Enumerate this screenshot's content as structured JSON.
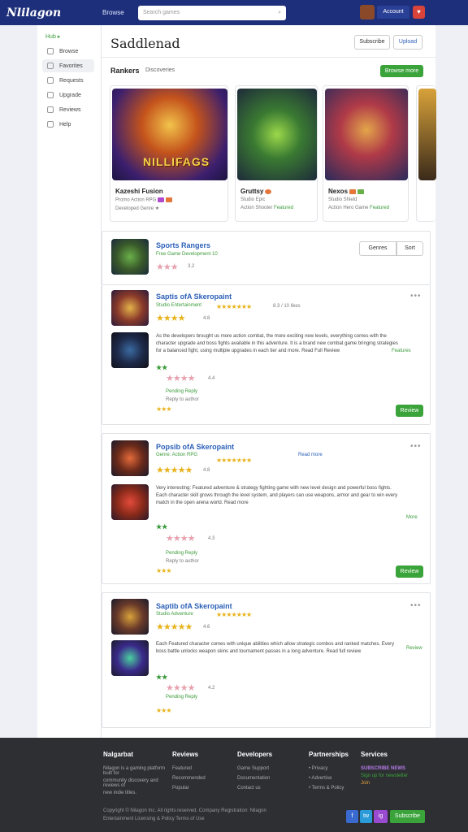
{
  "header": {
    "logo": "Nlilagon",
    "nav": "Browse",
    "search_placeholder": "Search games",
    "search_icon": "search-icon",
    "account": "Account",
    "notif": "♥"
  },
  "sidebar": {
    "heading": "Hub ▸",
    "items": [
      "Browse",
      "Favorites",
      "Requests",
      "Upgrade",
      "Reviews",
      "Help"
    ]
  },
  "page": {
    "title": "Saddlenad",
    "btn_share": "Subscribe",
    "btn_edit": "Upload"
  },
  "featured": {
    "title": "Rankers",
    "subtitle": "Discoveries",
    "action": "Browse more",
    "cards": [
      {
        "name": "Kazeshi Fusion",
        "line1": "Promo Action RPG",
        "line2": "Developed Genre ★",
        "logo": "NILLIFAGS"
      },
      {
        "name": "Gruttsy",
        "line1": "Studio Epic",
        "line2": "Action Shooter",
        "meta": "Featured"
      },
      {
        "name": "Nexos",
        "line1": "Studio Shield",
        "line2": "Action Hero Game",
        "meta": "Featured"
      }
    ]
  },
  "panels": [
    {
      "title": "Sports Rangers",
      "sub": "Free Game Development 10",
      "rating": "3.2",
      "filter": "Genres",
      "filter2": "Sort"
    },
    {
      "title": "Saptis ofA Skeropaint",
      "sub": "Studio Entertainment",
      "rating": "4.8",
      "meta": "8.3 / 10 likes",
      "review": "As the developers brought us more action combat, the more exciting new levels, everything comes with the character upgrade and boss fights available in this adventure. It is a brand new combat game bringing strategies for a balanced fight, using multiple upgrades in each tier and more. Read Full Review",
      "review_tag": "Features",
      "reply": "Pending Reply",
      "reply_sub": "Reply to author",
      "rating2": "4.4",
      "action": "Review"
    },
    {
      "title": "Popsib ofA Skeropaint",
      "sub": "Genre: Action RPG",
      "rating": "4.8",
      "link": "Read more",
      "review": "Very interesting: Featured adventure & strategy fighting game with new level design and powerful boss fights. Each character skill grows through the level system, and players can use weapons, armor and gear to win every match in the open arena world. Read more",
      "review_tag": "More",
      "reply": "Pending Reply",
      "reply_sub": "Reply to author",
      "rating2": "4.3",
      "action": "Review"
    },
    {
      "title": "Saptib ofA Skeropaint",
      "sub": "Studio Adventure",
      "rating": "4.6",
      "review": "Each Featured character comes with unique abilities which allow strategic combos and ranked matches. Every boss battle unlocks weapon skins and tournament passes in a long adventure. Read full review",
      "review_tag": "Review",
      "reply": "Pending Reply",
      "rating2": "4.2"
    }
  ],
  "footer": {
    "about_h": "Nalgarbat",
    "about": [
      "Nilagon is a gaming platform built for",
      "community discovery and reviews of",
      "new indie titles."
    ],
    "col1_h": "Reviews",
    "col1": [
      "Featured",
      "Recommended",
      "Popular"
    ],
    "col2_h": "Developers",
    "col2": [
      "Game Support",
      "Documentation",
      "Contact us"
    ],
    "col3_h": "Partnerships",
    "col3": [
      "• Privacy",
      "• Advertise",
      "• Terms & Policy"
    ],
    "col4_h": "Services",
    "col4": [
      "SUBSCRIBE NEWS",
      "Sign up for newsletter",
      "Join"
    ],
    "copyright": "Copyright © Nilagon Inc. All rights reserved. Company Registration: Nilagon Entertainment Licensing & Policy Terms of Use",
    "social": [
      "f",
      "tw",
      "ig"
    ],
    "cta": "Subscribe"
  },
  "colors": {
    "brand": "#1d2f7a",
    "accent": "#3aa33a",
    "link": "#2b5fb8",
    "star": "#e8b21a"
  }
}
